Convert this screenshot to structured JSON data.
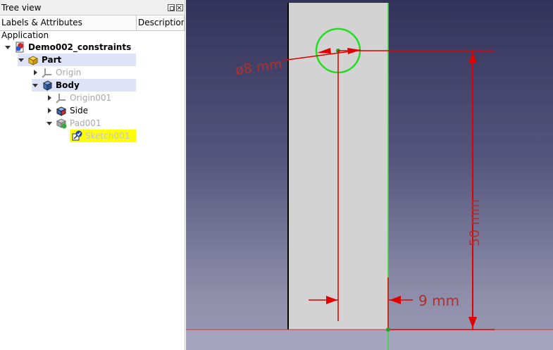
{
  "tree_view": {
    "title": "Tree view",
    "columns": [
      "Labels & Attributes",
      "Description"
    ],
    "root_label": "Application",
    "items": [
      {
        "label": "Demo002_constraints",
        "icon": "document-icon"
      },
      {
        "label": "Part",
        "icon": "part-icon"
      },
      {
        "label": "Origin",
        "icon": "origin-icon"
      },
      {
        "label": "Body",
        "icon": "body-icon"
      },
      {
        "label": "Origin001",
        "icon": "origin-icon"
      },
      {
        "label": "Side",
        "icon": "feature-icon"
      },
      {
        "label": "Pad001",
        "icon": "pad-icon"
      },
      {
        "label": "Sketch001",
        "icon": "sketch-icon"
      }
    ]
  },
  "viewport": {
    "dimensions": {
      "diameter": "ø8 mm",
      "height": "50 mm",
      "offset": "9 mm"
    },
    "colors": {
      "dimension": "#e00000",
      "dimension_text": "#b03030",
      "circle": "#22dd22",
      "part_face": "#d3d3d3"
    }
  }
}
